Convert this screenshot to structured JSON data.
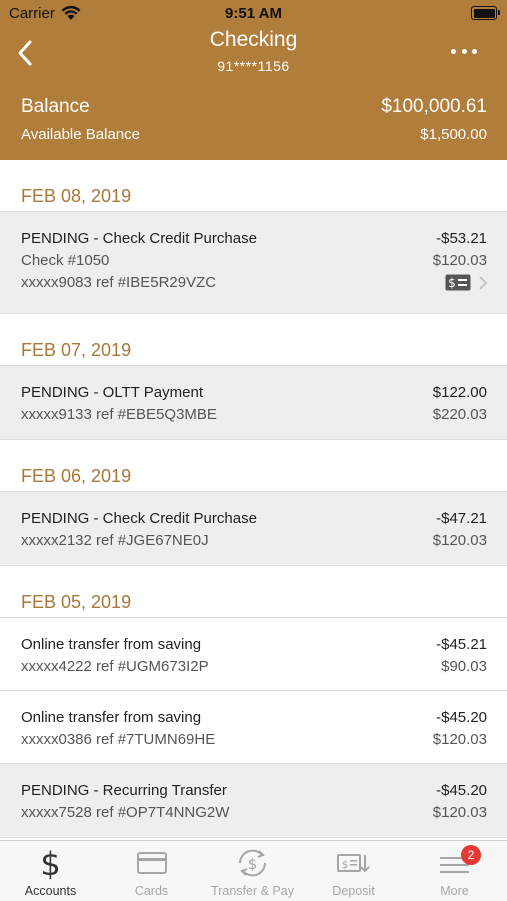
{
  "status": {
    "carrier": "Carrier",
    "time": "9:51 AM"
  },
  "header": {
    "title": "Checking",
    "account_number": "91****1156",
    "balance_label": "Balance",
    "balance_value": "$100,000.61",
    "available_label": "Available Balance",
    "available_value": "$1,500.00"
  },
  "groups": [
    {
      "date": "FEB 08, 2019",
      "transactions": [
        {
          "description": "PENDING - Check Credit Purchase",
          "check": "Check #1050",
          "ref": "xxxxx9083 ref #IBE5R29VZC",
          "amount": "-$53.21",
          "balance": "$120.03"
        }
      ]
    },
    {
      "date": "FEB 07, 2019",
      "transactions": [
        {
          "description": "PENDING - OLTT Payment",
          "ref": "xxxxx9133 ref #EBE5Q3MBE",
          "amount": "$122.00",
          "balance": "$220.03"
        }
      ]
    },
    {
      "date": "FEB 06, 2019",
      "transactions": [
        {
          "description": "PENDING - Check Credit Purchase",
          "ref": "xxxxx2132 ref #JGE67NE0J",
          "amount": "-$47.21",
          "balance": "$120.03"
        }
      ]
    },
    {
      "date": "FEB 05, 2019",
      "transactions": [
        {
          "description": "Online transfer from saving",
          "ref": "xxxxx4222 ref #UGM673I2P",
          "amount": "-$45.21",
          "balance": "$90.03"
        },
        {
          "description": "Online transfer from saving",
          "ref": "xxxxx0386 ref #7TUMN69HE",
          "amount": "-$45.20",
          "balance": "$120.03"
        },
        {
          "description": "PENDING - Recurring Transfer",
          "ref": "xxxxx7528 ref #OP7T4NNG2W",
          "amount": "-$45.20",
          "balance": "$120.03"
        }
      ]
    }
  ],
  "tabs": [
    {
      "label": "Accounts",
      "icon": "dollar-icon"
    },
    {
      "label": "Cards",
      "icon": "card-icon"
    },
    {
      "label": "Transfer & Pay",
      "icon": "transfer-icon"
    },
    {
      "label": "Deposit",
      "icon": "deposit-icon"
    },
    {
      "label": "More",
      "icon": "menu-icon",
      "badge": "2"
    }
  ],
  "colors": {
    "brand": "#b07d3a",
    "date_text": "#a8783a",
    "pending_bg": "#eeeeee",
    "badge": "#e53935"
  }
}
